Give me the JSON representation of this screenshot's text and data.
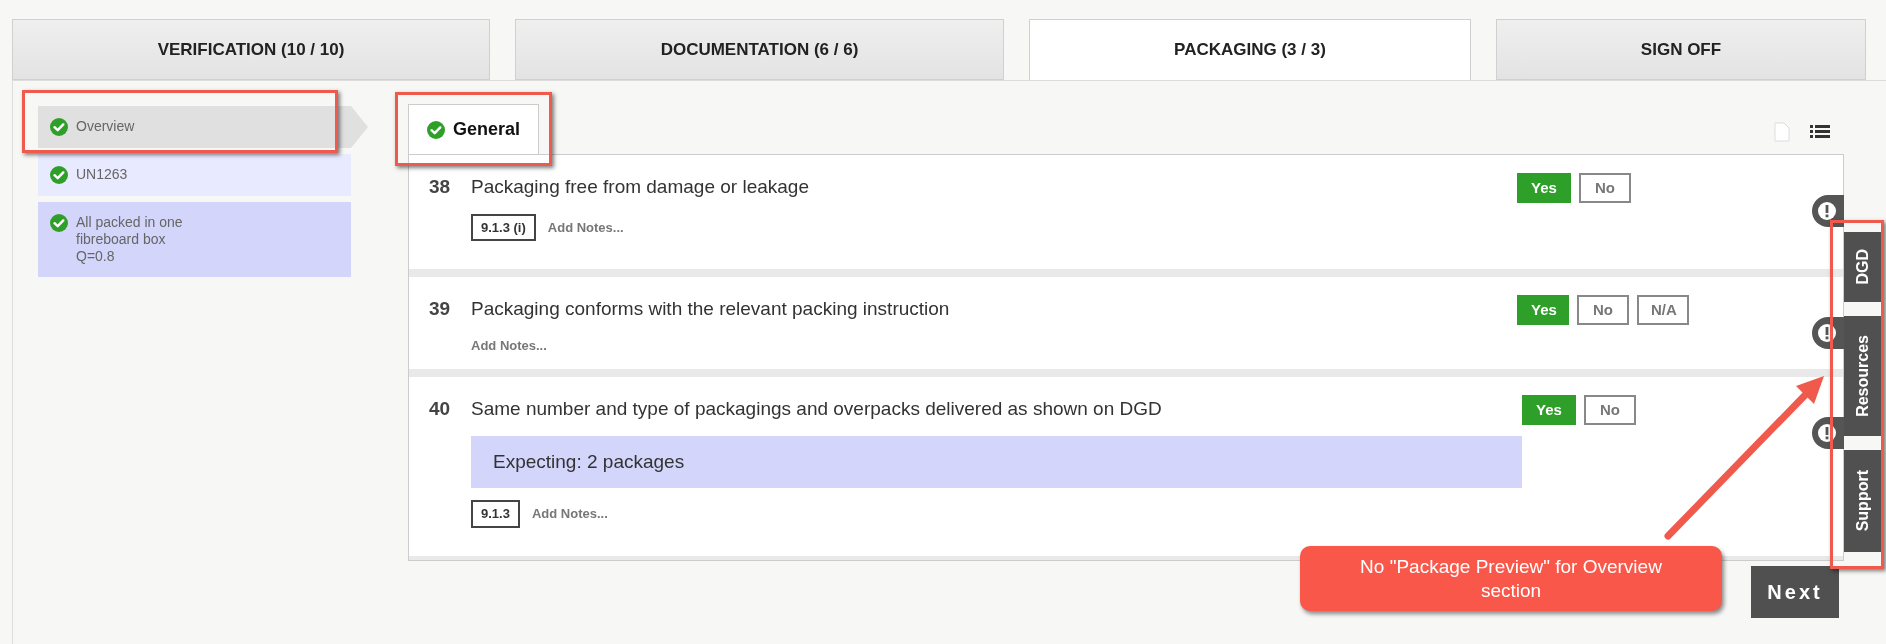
{
  "tabs": [
    {
      "label": "VERIFICATION (10 / 10)",
      "selected": false
    },
    {
      "label": "DOCUMENTATION (6 / 6)",
      "selected": false
    },
    {
      "label": "PACKAGING (3 / 3)",
      "selected": true
    },
    {
      "label": "SIGN OFF",
      "selected": false
    }
  ],
  "sidebar": {
    "items": [
      {
        "label": "Overview",
        "selected": true,
        "color": "#e0e0e0",
        "done": true
      },
      {
        "label": "UN1263",
        "selected": false,
        "color": "#e8eaff",
        "done": true
      },
      {
        "label": "All packed in one\nfibreboard box\nQ=0.8",
        "selected": false,
        "color": "#d3d5fb",
        "done": true
      }
    ]
  },
  "section_tabs": [
    {
      "label": "General",
      "selected": true,
      "done": true
    }
  ],
  "questions": [
    {
      "number": "38",
      "text": "Packaging free from damage or leakage",
      "reference": "9.1.3 (i)",
      "notes": "Add Notes...",
      "options": [
        {
          "label": "Yes",
          "selected": true
        },
        {
          "label": "No",
          "selected": false
        }
      ]
    },
    {
      "number": "39",
      "text": "Packaging conforms with the relevant packing instruction",
      "notes": "Add Notes...",
      "options": [
        {
          "label": "Yes",
          "selected": true
        },
        {
          "label": "No",
          "selected": false
        },
        {
          "label": "N/A",
          "selected": false
        }
      ]
    },
    {
      "number": "40",
      "text": "Same number and type of packagings and overpacks delivered as shown on DGD",
      "expectation": "Expecting: 2 packages",
      "reference": "9.1.3",
      "notes": "Add Notes...",
      "options": [
        {
          "label": "Yes",
          "selected": true
        },
        {
          "label": "No",
          "selected": false
        }
      ]
    }
  ],
  "side_tabs": [
    "DGD",
    "Resources",
    "Support"
  ],
  "next_button": "Next",
  "annotation": {
    "callout": "No \"Package Preview\" for Overview section"
  }
}
